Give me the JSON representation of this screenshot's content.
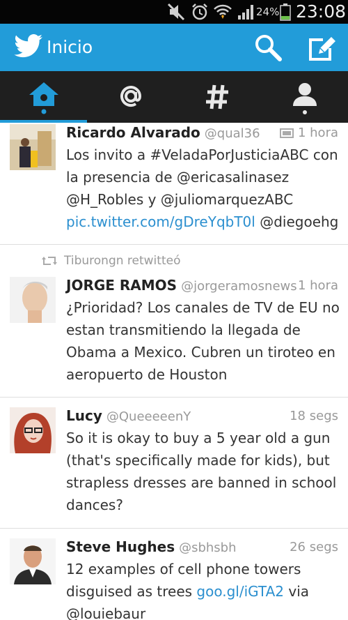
{
  "status_bar": {
    "battery": "24%",
    "time": "23:08"
  },
  "header": {
    "title": "Inicio"
  },
  "tabs": [
    {
      "name": "home",
      "icon": "home-icon",
      "active": true
    },
    {
      "name": "mentions",
      "icon": "at-icon"
    },
    {
      "name": "discover",
      "icon": "hashtag-icon"
    },
    {
      "name": "me",
      "icon": "person-icon"
    }
  ],
  "colors": {
    "accent": "#229cd9",
    "link": "#2b8fcf",
    "tab_bg": "#1f1f1f"
  },
  "tweets": [
    {
      "name": "Ricardo Alvarado",
      "handle": "@qual36",
      "time": "1 hora",
      "has_media": true,
      "text_pre": "Los invito a #VeladaPorJusticiaABC con la presencia de @ericasalinasez @H_Robles y @juliomarquezABC ",
      "text_link": "pic.twitter.com/gDreYqbT0l",
      "text_post": " @diegoehg"
    },
    {
      "retweeted_by": "Tiburongn retwitteó",
      "name": "JORGE RAMOS",
      "handle": "@jorgeramosnews",
      "time": "1 hora",
      "text_pre": "¿Prioridad? Los canales de TV de EU no estan transmitiendo la llegada de Obama a Mexico. Cubren un tiroteo en aeropuerto de Houston",
      "text_link": "",
      "text_post": ""
    },
    {
      "name": "Lucy",
      "handle": "@QueeeeenY",
      "time": "18 segs",
      "text_pre": "So it is okay to buy a 5 year old a gun (that's specifically made for kids), but strapless dresses are banned in school dances?",
      "text_link": "",
      "text_post": ""
    },
    {
      "name": "Steve Hughes",
      "handle": "@sbhsbh",
      "time": "26 segs",
      "text_pre": "12 examples of cell phone towers disguised as trees ",
      "text_link": "goo.gl/iGTA2",
      "text_post": " via @louiebaur"
    }
  ]
}
